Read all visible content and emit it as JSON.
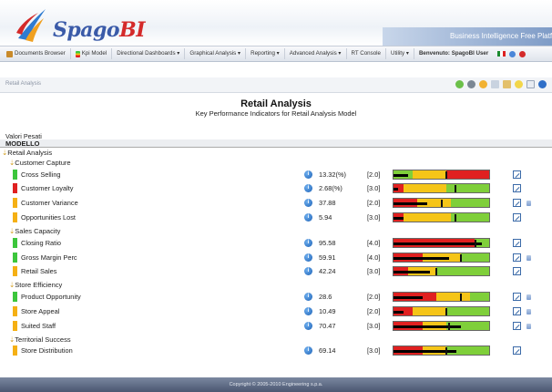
{
  "app": {
    "logo_text_main": "Spago",
    "logo_text_accent": "BI",
    "banner": "Business Intelligence Free Platform"
  },
  "menu": {
    "items": [
      {
        "label": "Documents Browser",
        "icon": "documents-icon"
      },
      {
        "label": "Kpi Model",
        "icon": "kpi-icon"
      },
      {
        "label": "Directional Dashboards ▾"
      },
      {
        "label": "Graphical Analysis ▾"
      },
      {
        "label": "Reporting ▾"
      },
      {
        "label": "Advanced Analysis ▾"
      },
      {
        "label": "RT Console"
      },
      {
        "label": "Utility ▾"
      }
    ],
    "user_label": "Benvenuto: SpagoBI User"
  },
  "toolbar": {
    "breadcrumb": "Retail Analysis"
  },
  "page": {
    "title": "Retail Analysis",
    "subtitle": "Key Performance Indicators for Retail Analysis Model",
    "weights_label": "Valori Pesati",
    "model_header": "MODELLO",
    "root": "Retail Analysis"
  },
  "colors": {
    "red": "#e02020",
    "yellow": "#f5c518",
    "green": "#7fcf3a",
    "semaphore_green": "#3cc63c",
    "semaphore_red": "#e02020",
    "semaphore_orange": "#f5b014"
  },
  "groups": [
    {
      "name": "Customer Capture",
      "kpis": [
        {
          "name": "Cross Selling",
          "status": "green",
          "value": "13.32(%)",
          "weight": "[2.0]",
          "perf": 0.15,
          "target": 0.55,
          "segments": [
            [
              "green",
              0,
              0.2
            ],
            [
              "yellow",
              0.2,
              0.55
            ],
            [
              "red",
              0.55,
              1
            ]
          ],
          "note": false
        },
        {
          "name": "Customer Loyalty",
          "status": "red",
          "value": "2.68(%)",
          "weight": "[3.0]",
          "perf": 0.05,
          "target": 0.65,
          "segments": [
            [
              "red",
              0,
              0.1
            ],
            [
              "yellow",
              0.1,
              0.55
            ],
            [
              "green",
              0.55,
              1
            ]
          ],
          "note": false
        },
        {
          "name": "Customer Variance",
          "status": "orange",
          "value": "37.88",
          "weight": "[2.0]",
          "perf": 0.35,
          "target": 0.5,
          "segments": [
            [
              "red",
              0,
              0.25
            ],
            [
              "yellow",
              0.25,
              0.6
            ],
            [
              "green",
              0.6,
              1
            ]
          ],
          "note": true
        },
        {
          "name": "Opportunities Lost",
          "status": "orange",
          "value": "5.94",
          "weight": "[3.0]",
          "perf": 0.1,
          "target": 0.65,
          "segments": [
            [
              "red",
              0,
              0.1
            ],
            [
              "yellow",
              0.1,
              0.6
            ],
            [
              "green",
              0.6,
              1
            ]
          ],
          "note": false
        }
      ]
    },
    {
      "name": "Sales Capacity",
      "kpis": [
        {
          "name": "Closing Ratio",
          "status": "green",
          "value": "95.58",
          "weight": "[4.0]",
          "perf": 0.92,
          "target": 0.86,
          "segments": [
            [
              "red",
              0,
              0.85
            ],
            [
              "green",
              0.85,
              1
            ]
          ],
          "note": false
        },
        {
          "name": "Gross Margin Perc",
          "status": "green",
          "value": "59.91",
          "weight": "[4.0]",
          "perf": 0.58,
          "target": 0.7,
          "segments": [
            [
              "red",
              0,
              0.3
            ],
            [
              "yellow",
              0.3,
              0.7
            ],
            [
              "green",
              0.7,
              1
            ]
          ],
          "note": true
        },
        {
          "name": "Retail Sales",
          "status": "orange",
          "value": "42.24",
          "weight": "[3.0]",
          "perf": 0.38,
          "target": 0.45,
          "segments": [
            [
              "red",
              0,
              0.15
            ],
            [
              "yellow",
              0.15,
              0.45
            ],
            [
              "green",
              0.45,
              1
            ]
          ],
          "note": false
        }
      ]
    },
    {
      "name": "Store Efficiency",
      "kpis": [
        {
          "name": "Product Opportunity",
          "status": "green",
          "value": "28.6",
          "weight": "[2.0]",
          "perf": 0.3,
          "target": 0.7,
          "segments": [
            [
              "red",
              0,
              0.45
            ],
            [
              "yellow",
              0.45,
              0.8
            ],
            [
              "green",
              0.8,
              1
            ]
          ],
          "note": true
        },
        {
          "name": "Store Appeal",
          "status": "orange",
          "value": "10.49",
          "weight": "[2.0]",
          "perf": 0.1,
          "target": 0.55,
          "segments": [
            [
              "red",
              0,
              0.2
            ],
            [
              "yellow",
              0.2,
              0.55
            ],
            [
              "green",
              0.55,
              1
            ]
          ],
          "note": true
        },
        {
          "name": "Suited Staff",
          "status": "orange",
          "value": "70.47",
          "weight": "[3.0]",
          "perf": 0.7,
          "target": 0.58,
          "segments": [
            [
              "red",
              0,
              0.3
            ],
            [
              "yellow",
              0.3,
              0.55
            ],
            [
              "green",
              0.55,
              1
            ]
          ],
          "note": true
        }
      ]
    },
    {
      "name": "Territorial Success",
      "kpis": [
        {
          "name": "Store Distribution",
          "status": "orange",
          "value": "69.14",
          "weight": "[3.0]",
          "perf": 0.66,
          "target": 0.55,
          "segments": [
            [
              "red",
              0,
              0.3
            ],
            [
              "yellow",
              0.3,
              0.55
            ],
            [
              "green",
              0.55,
              1
            ]
          ],
          "note": false
        }
      ]
    }
  ],
  "footer": {
    "copyright": "Copyright © 2005-2010 Engineering s.p.a."
  }
}
